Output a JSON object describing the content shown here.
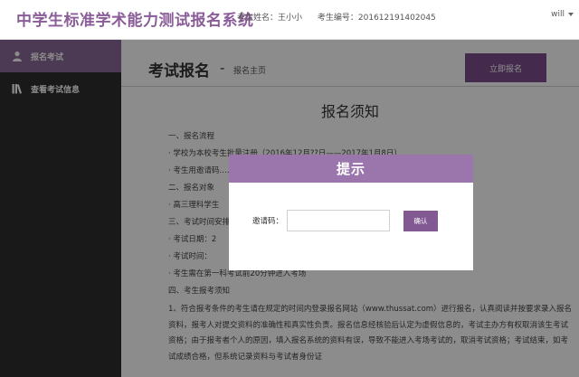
{
  "header": {
    "app_title": "中学生标准学术能力测试报名系统",
    "student_name": "考生姓名：王小小",
    "student_id": "考生编号：201612191402045",
    "user": "will"
  },
  "sidebar": {
    "items": [
      {
        "label": "报名考试",
        "icon": "user-icon",
        "active": true
      },
      {
        "label": "查看考试信息",
        "icon": "books-icon",
        "active": false
      }
    ]
  },
  "main": {
    "page_title": "考试报名",
    "separator": "-",
    "subtitle": "报名主页",
    "signup_button": "立即报名",
    "notice_title": "报名须知",
    "notice_lines": [
      "一、报名流程",
      "· 学校为本校考生批量注册（2016年12月??日——2017年1月8日）",
      "· 考生用邀请码……13日）",
      "二、报名对象",
      "· 高三理科学生",
      "三、考试时间安排",
      "· 考试日期：2",
      "· 考试时间：",
      "· 考生需在第一科考试前20分钟进入考场",
      "四、考生报考须知"
    ],
    "notice_paragraph": "1、符合报考条件的考生请在规定的时间内登录报名网站（www.thussat.com）进行报名，认真阅读并按要求录入报名资料，报考人对提交资料的准确性和真实性负责。报名信息经核验后认定为虚假信息的，考试主办方有权取消该生考试资格；由于报考者个人的原因，填入报名系统的资料有误，导致不能进入考场考试的，取消考试资格；考试结束，如考试成绩合格，但系统记录资料与考试者身份证"
  },
  "modal": {
    "title": "提示",
    "code_label": "邀请码：",
    "code_value": "",
    "code_placeholder": "",
    "confirm_button": "确认"
  }
}
